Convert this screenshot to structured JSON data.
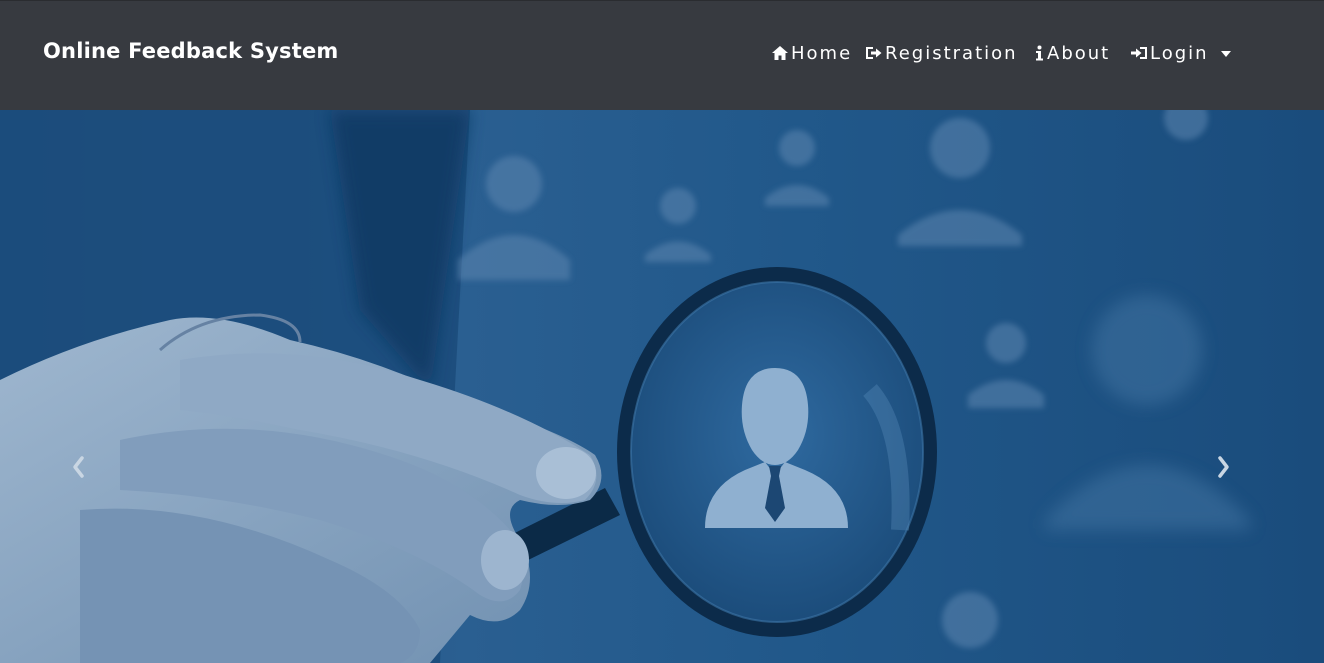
{
  "navbar": {
    "brand": "Online Feedback System",
    "items": [
      {
        "label": "Home",
        "icon": "home-icon"
      },
      {
        "label": "Registration",
        "icon": "sign-in-icon"
      },
      {
        "label": "About",
        "icon": "info-icon"
      },
      {
        "label": "Login",
        "icon": "login-icon",
        "dropdown": true
      }
    ],
    "background": "#373a40"
  },
  "carousel": {
    "image": "hand holding magnifying glass over person icon",
    "prev_icon": "chevron-left-icon",
    "next_icon": "chevron-right-icon",
    "tint": "#1d4f7e"
  }
}
